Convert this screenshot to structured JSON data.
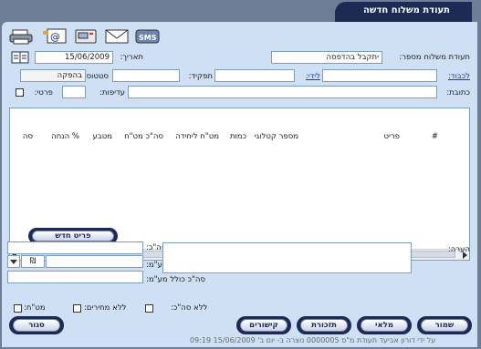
{
  "window": {
    "title": "תעודת משלוח חדשה"
  },
  "toolbar": {
    "print": "print-icon",
    "email": "email-icon",
    "fax": "fax-icon",
    "mail": "envelope-icon",
    "sms": "SMS"
  },
  "header": {
    "doc_number_label": "תעודת משלוח מספר:",
    "doc_number_value": "יתקבל בהדפסה",
    "date_label": "תאריך:",
    "date_value": "15/06/2009",
    "to_label": "לכבוד:",
    "attn_label": "לידי:",
    "role_label": "תפקיד:",
    "status_label": "סטטוס:",
    "status_value": "בהפקה",
    "address_label": "כתובת:",
    "priority_label": "עדיפות:",
    "private_label": "פרטי:"
  },
  "grid": {
    "columns": [
      "#",
      "פריט",
      "מספר קטלוגי",
      "כמות",
      "מט\"ח ליחידה",
      "סה\"כ מט\"ח",
      "מטבע",
      "% הנחה",
      "סה"
    ],
    "new_item_label": "פריט חדש"
  },
  "totals": {
    "total_label": "סה\"כ:",
    "vat_label": "מע\"מ:",
    "vat_currency": "₪",
    "total_incl_vat_label": "סה\"כ כולל מע\"מ:",
    "note_label": "הערה:"
  },
  "options": {
    "no_total_label": "ללא סה\"כ:",
    "no_prices_label": "ללא מחירים:",
    "fx_label": "מט\"ח:"
  },
  "buttons": {
    "save": "שמור",
    "fill": "מלאי",
    "reminder": "תזכורת",
    "links": "קישורים",
    "close": "סגור"
  },
  "status": {
    "created": "תעודת מ\"ס 0000005 נוצרה ב- יום ב' 15/06/2009 09:19",
    "by": "על ידי דורון אביעד"
  }
}
